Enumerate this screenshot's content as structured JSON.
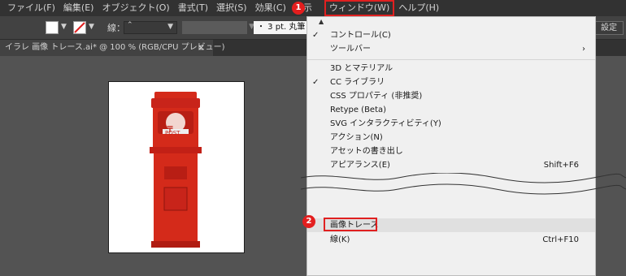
{
  "menubar": {
    "items": [
      "ファイル(F)",
      "編集(E)",
      "オブジェクト(O)",
      "書式(T)",
      "選択(S)",
      "効果(C)",
      "表示",
      "ウィンドウ(W)",
      "ヘルプ(H)"
    ]
  },
  "control": {
    "stroke_label": "線：",
    "brush_value": "・ 3 pt. 丸筆",
    "settings_label": "設定"
  },
  "tab": {
    "title": "イラレ 画像 トレース.ai* @ 100 % (RGB/CPU プレビュー)",
    "close_glyph": "×"
  },
  "window_menu": {
    "items": [
      {
        "label": "コントロール(C)",
        "checked": "✓",
        "shortcut": "",
        "submenu": ""
      },
      {
        "label": "ツールバー",
        "checked": "",
        "shortcut": "",
        "submenu": "›"
      },
      {
        "label": "3D とマテリアル",
        "checked": "",
        "shortcut": "",
        "submenu": ""
      },
      {
        "label": "CC ライブラリ",
        "checked": "✓",
        "shortcut": "",
        "submenu": ""
      },
      {
        "label": "CSS プロパティ (非推奨)",
        "checked": "",
        "shortcut": "",
        "submenu": ""
      },
      {
        "label": "Retype (Beta)",
        "checked": "",
        "shortcut": "",
        "submenu": ""
      },
      {
        "label": "SVG インタラクティビティ(Y)",
        "checked": "",
        "shortcut": "",
        "submenu": ""
      },
      {
        "label": "アクション(N)",
        "checked": "",
        "shortcut": "",
        "submenu": ""
      },
      {
        "label": "アセットの書き出し",
        "checked": "",
        "shortcut": "",
        "submenu": ""
      },
      {
        "label": "アピアランス(E)",
        "checked": "",
        "shortcut": "Shift+F6",
        "submenu": ""
      },
      {
        "label": "画像トレース",
        "checked": "",
        "shortcut": "",
        "submenu": ""
      },
      {
        "label": "線(K)",
        "checked": "",
        "shortcut": "Ctrl+F10",
        "submenu": ""
      }
    ]
  },
  "badges": {
    "one": "1",
    "two": "2"
  },
  "postbox": {
    "sign": "〒",
    "text": "POST"
  },
  "icons": {
    "scroll_up": "▲",
    "dropdown": "chevron-down-icon",
    "close": "close-icon"
  },
  "colors": {
    "accent_red": "#e02020",
    "postbox_red": "#d42a1a"
  }
}
